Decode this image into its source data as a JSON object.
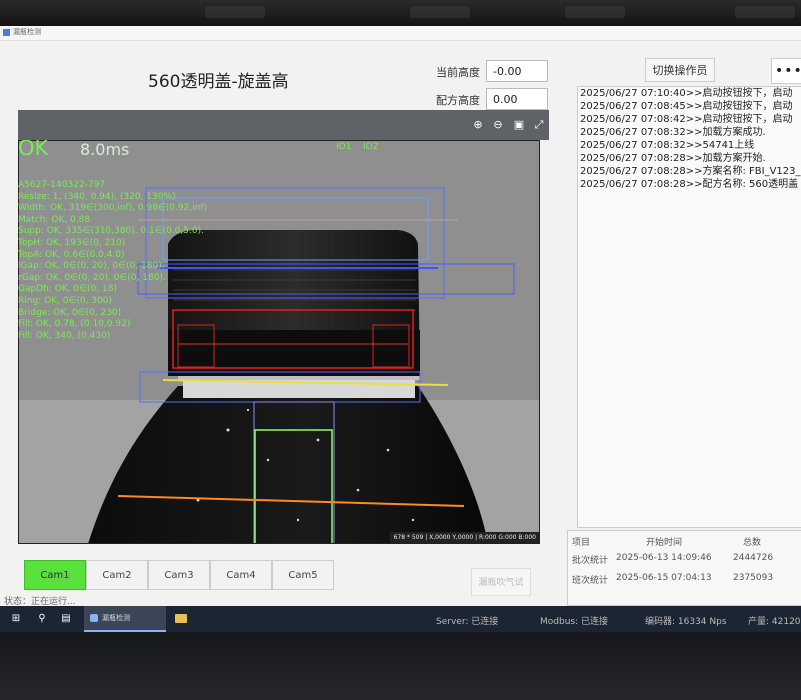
{
  "window_title": "漏瓶检测",
  "main_title": "560透明盖-旋盖高",
  "fields": {
    "current_height_label": "当前高度",
    "current_height_value": "-0.00",
    "recipe_height_label": "配方高度",
    "recipe_height_value": "0.00"
  },
  "operator": {
    "switch_label": "切换操作员",
    "password_mask": "••••"
  },
  "viewer": {
    "result": "OK",
    "time_ms": "8.0ms",
    "io1": "IO1",
    "io2": "IO2",
    "measurements": [
      "A5627-140322-797",
      "Resize: 1, (340, 0.94), (320, 130%)",
      "Width: OK, 319∈(300,inf), 0.98∈(0.92,inf)",
      "Match: OK, 0.88",
      "Supp: OK, 335∈(310,380), 0.1∈(0.0,5.0).",
      "TopH: OK, 193∈(0, 210)",
      "TopA: OK, 0.6∈(0.0,4.0)",
      "lGap: OK, 0∈(0, 20), 0∈(0, 180).",
      "rGap: OK, 0∈(0, 20), 0∈(0, 180).",
      "GapDh: OK, 0∈(0, 18)",
      "Ring: OK, 0∈(0, 300)",
      "Bridge: OK, 0∈(0, 230)",
      "Fill: OK, 0.78, (0.10,0.92)",
      "Fill: OK, 340, (0,430)"
    ],
    "status_bar": "678 * 509  |  X,0000  Y,0000  |  R:000  G:000  B:000"
  },
  "cameras": [
    "Cam1",
    "Cam2",
    "Cam3",
    "Cam4",
    "Cam5"
  ],
  "active_camera": "Cam1",
  "blow_button": "漏瓶吹气试",
  "state_label": "状态：正在运行...",
  "log": [
    "2025/06/27 07:10:40>>启动按钮按下，启动",
    "2025/06/27 07:08:45>>启动按钮按下，启动",
    "2025/06/27 07:08:42>>启动按钮按下，启动",
    "2025/06/27 07:08:32>>加载方案成功.",
    "2025/06/27 07:08:32>>54741上线",
    "2025/06/27 07:08:28>>加载方案开始.",
    "2025/06/27 07:08:28>>方案名称: FBI_V123_",
    "2025/06/27 07:08:28>>配方名称: 560透明盖"
  ],
  "stats": {
    "headers": [
      "项目",
      "开始时间",
      "总数"
    ],
    "rows": [
      [
        "批次统计",
        "2025-06-13 14:09:46",
        "2444726"
      ],
      [
        "班次统计",
        "2025-06-15 07:04:13",
        "2375093"
      ]
    ]
  },
  "statusbar": {
    "server": "Server: 已连接",
    "modbus": "Modbus: 已连接",
    "encoder": "编码器: 16334 Nps",
    "output": "产量: 42120"
  }
}
